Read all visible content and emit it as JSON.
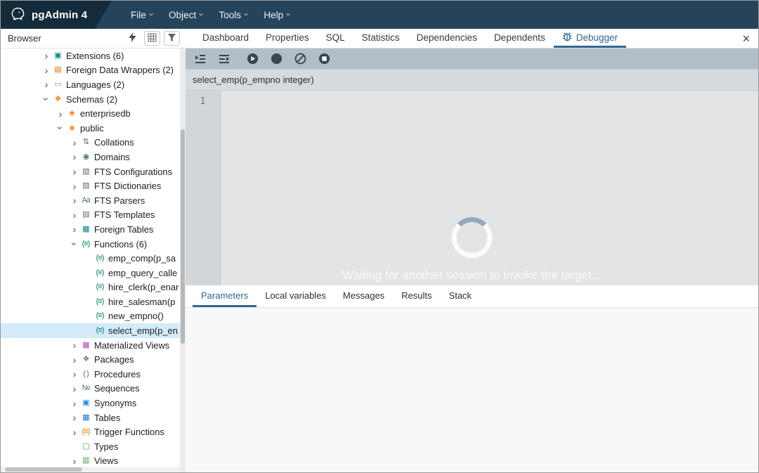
{
  "colors": {
    "accent_blue": "#326690",
    "selection_blue": "#d4ebf9",
    "topbar": "#25445c",
    "toolbar_gray": "#b2bec7"
  },
  "topbar": {
    "title": "pgAdmin 4",
    "menus": [
      {
        "label": "File"
      },
      {
        "label": "Object"
      },
      {
        "label": "Tools"
      },
      {
        "label": "Help"
      }
    ]
  },
  "browser_panel": {
    "title": "Browser",
    "buttons": [
      {
        "name": "lightning-button",
        "icon": "lightning-icon",
        "bordered": false
      },
      {
        "name": "grid-button",
        "icon": "grid-icon",
        "bordered": true
      },
      {
        "name": "filter-button",
        "icon": "funnel-icon",
        "bordered": true
      }
    ]
  },
  "tabbar": {
    "tabs": [
      {
        "label": "Dashboard",
        "active": false
      },
      {
        "label": "Properties",
        "active": false
      },
      {
        "label": "SQL",
        "active": false
      },
      {
        "label": "Statistics",
        "active": false
      },
      {
        "label": "Dependencies",
        "active": false
      },
      {
        "label": "Dependents",
        "active": false
      },
      {
        "label": "Debugger",
        "active": true,
        "icon": "bug-icon"
      }
    ],
    "close_icon": "×"
  },
  "tree": {
    "items": [
      {
        "label": "Extensions (6)",
        "depth": 1,
        "chevron": "right",
        "icon": "extensions"
      },
      {
        "label": "Foreign Data Wrappers (2)",
        "depth": 1,
        "chevron": "right",
        "icon": "fdw"
      },
      {
        "label": "Languages (2)",
        "depth": 1,
        "chevron": "right",
        "icon": "languages"
      },
      {
        "label": "Schemas (2)",
        "depth": 1,
        "chevron": "down",
        "icon": "schemas"
      },
      {
        "label": "enterprisedb",
        "depth": 2,
        "chevron": "right",
        "icon": "schema"
      },
      {
        "label": "public",
        "depth": 2,
        "chevron": "down",
        "icon": "schema"
      },
      {
        "label": "Collations",
        "depth": 3,
        "chevron": "right",
        "icon": "collations"
      },
      {
        "label": "Domains",
        "depth": 3,
        "chevron": "right",
        "icon": "domains"
      },
      {
        "label": "FTS Configurations",
        "depth": 3,
        "chevron": "right",
        "icon": "fts-config"
      },
      {
        "label": "FTS Dictionaries",
        "depth": 3,
        "chevron": "right",
        "icon": "fts-dict"
      },
      {
        "label": "FTS Parsers",
        "depth": 3,
        "chevron": "right",
        "icon": "fts-parsers"
      },
      {
        "label": "FTS Templates",
        "depth": 3,
        "chevron": "right",
        "icon": "fts-templates"
      },
      {
        "label": "Foreign Tables",
        "depth": 3,
        "chevron": "right",
        "icon": "foreign-tables"
      },
      {
        "label": "Functions (6)",
        "depth": 3,
        "chevron": "down",
        "icon": "functions"
      },
      {
        "label": "emp_comp(p_sa",
        "depth": 4,
        "chevron": "none",
        "icon": "function"
      },
      {
        "label": "emp_query_calle",
        "depth": 4,
        "chevron": "none",
        "icon": "function"
      },
      {
        "label": "hire_clerk(p_enar",
        "depth": 4,
        "chevron": "none",
        "icon": "function"
      },
      {
        "label": "hire_salesman(p",
        "depth": 4,
        "chevron": "none",
        "icon": "function"
      },
      {
        "label": "new_empno()",
        "depth": 4,
        "chevron": "none",
        "icon": "function"
      },
      {
        "label": "select_emp(p_en",
        "depth": 4,
        "chevron": "none",
        "icon": "function",
        "selected": true
      },
      {
        "label": "Materialized Views",
        "depth": 3,
        "chevron": "right",
        "icon": "mat-views"
      },
      {
        "label": "Packages",
        "depth": 3,
        "chevron": "right",
        "icon": "packages"
      },
      {
        "label": "Procedures",
        "depth": 3,
        "chevron": "right",
        "icon": "procedures"
      },
      {
        "label": "Sequences",
        "depth": 3,
        "chevron": "right",
        "icon": "sequences"
      },
      {
        "label": "Synonyms",
        "depth": 3,
        "chevron": "right",
        "icon": "synonyms"
      },
      {
        "label": "Tables",
        "depth": 3,
        "chevron": "right",
        "icon": "tables"
      },
      {
        "label": "Trigger Functions",
        "depth": 3,
        "chevron": "right",
        "icon": "trigger-functions"
      },
      {
        "label": "Types",
        "depth": 3,
        "chevron": "none",
        "icon": "types"
      },
      {
        "label": "Views",
        "depth": 3,
        "chevron": "right",
        "icon": "views"
      }
    ]
  },
  "tree_icons": {
    "extensions": {
      "glyph": "▣",
      "color": "#00897b"
    },
    "fdw": {
      "glyph": "▤",
      "color": "#ef6c00"
    },
    "languages": {
      "glyph": "▭",
      "color": "#78909c"
    },
    "schemas": {
      "glyph": "❖",
      "color": "#f57c00"
    },
    "schema": {
      "glyph": "◈",
      "color": "#f57c00"
    },
    "collations": {
      "glyph": "⇅",
      "color": "#546e7a"
    },
    "domains": {
      "glyph": "◉",
      "color": "#546e7a"
    },
    "fts-config": {
      "glyph": "▧",
      "color": "#546e7a"
    },
    "fts-dict": {
      "glyph": "▨",
      "color": "#546e7a"
    },
    "fts-parsers": {
      "glyph": "Aa",
      "color": "#546e7a"
    },
    "fts-templates": {
      "glyph": "▤",
      "color": "#546e7a"
    },
    "foreign-tables": {
      "glyph": "▦",
      "color": "#00838f"
    },
    "functions": {
      "glyph": "(≡)",
      "color": "#00796b"
    },
    "function": {
      "glyph": "(≡)",
      "color": "#00796b"
    },
    "mat-views": {
      "glyph": "▦",
      "color": "#ab47bc"
    },
    "packages": {
      "glyph": "❖",
      "color": "#8d6e63"
    },
    "procedures": {
      "glyph": "( )",
      "color": "#546e7a"
    },
    "sequences": {
      "glyph": "№",
      "color": "#546e7a"
    },
    "synonyms": {
      "glyph": "▣",
      "color": "#1e88e5"
    },
    "tables": {
      "glyph": "▦",
      "color": "#1976d2"
    },
    "trigger-functions": {
      "glyph": "(≡)",
      "color": "#ef6c00"
    },
    "types": {
      "glyph": "▢",
      "color": "#43a047"
    },
    "views": {
      "glyph": "▥",
      "color": "#43a047"
    }
  },
  "debugger": {
    "toolbar": [
      {
        "name": "step-into-button",
        "icon": "step-into-icon"
      },
      {
        "name": "step-over-button",
        "icon": "step-over-icon"
      },
      {
        "name": "continue-button",
        "icon": "continue-icon"
      },
      {
        "name": "toggle-breakpoint-button",
        "icon": "toggle-breakpoint-icon"
      },
      {
        "name": "clear-all-breakpoints-button",
        "icon": "clear-breakpoints-icon"
      },
      {
        "name": "stop-button",
        "icon": "stop-icon"
      }
    ],
    "signature": "select_emp(p_empno integer)",
    "editor": {
      "line_numbers": [
        "1"
      ]
    },
    "status_text": "Waiting for another session to invoke the target...",
    "bottom_tabs": [
      {
        "label": "Parameters",
        "active": true
      },
      {
        "label": "Local variables",
        "active": false
      },
      {
        "label": "Messages",
        "active": false
      },
      {
        "label": "Results",
        "active": false
      },
      {
        "label": "Stack",
        "active": false
      }
    ]
  }
}
